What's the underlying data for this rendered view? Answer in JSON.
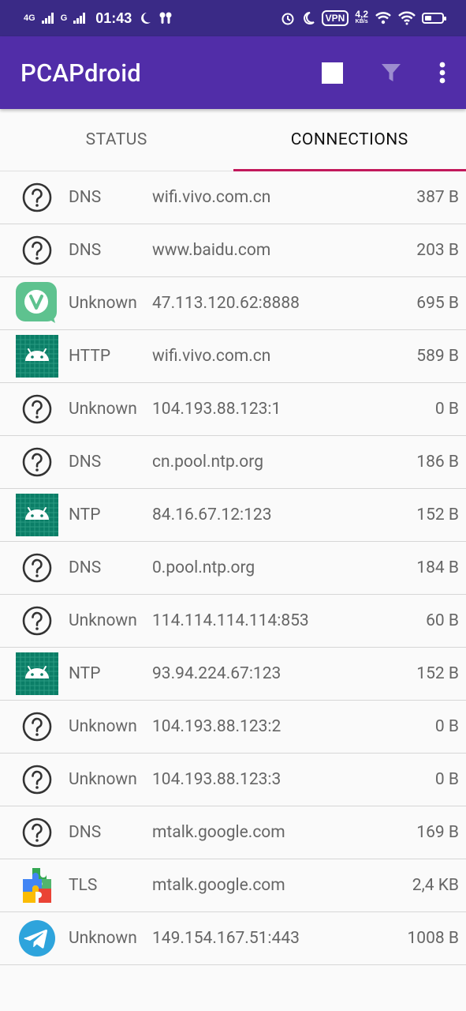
{
  "status_bar": {
    "network_left": "4G",
    "network_right": "G",
    "time": "01:43",
    "vpn": "VPN",
    "speed_value": "4,2",
    "speed_unit": "KB/s"
  },
  "appbar": {
    "title": "PCAPdroid"
  },
  "tabs": [
    {
      "label": "STATUS",
      "active": false
    },
    {
      "label": "CONNECTIONS",
      "active": true
    }
  ],
  "connections": [
    {
      "icon": "unknown-app-icon",
      "protocol": "DNS",
      "host": "wifi.vivo.com.cn",
      "size": "387 B"
    },
    {
      "icon": "unknown-app-icon",
      "protocol": "DNS",
      "host": "www.baidu.com",
      "size": "203 B"
    },
    {
      "icon": "vivo-v-icon",
      "protocol": "Unknown",
      "host": "47.113.120.62:8888",
      "size": "695 B"
    },
    {
      "icon": "android-system-icon",
      "protocol": "HTTP",
      "host": "wifi.vivo.com.cn",
      "size": "589 B"
    },
    {
      "icon": "unknown-app-icon",
      "protocol": "Unknown",
      "host": "104.193.88.123:1",
      "size": "0 B"
    },
    {
      "icon": "unknown-app-icon",
      "protocol": "DNS",
      "host": "cn.pool.ntp.org",
      "size": "186 B"
    },
    {
      "icon": "android-system-icon",
      "protocol": "NTP",
      "host": "84.16.67.12:123",
      "size": "152 B"
    },
    {
      "icon": "unknown-app-icon",
      "protocol": "DNS",
      "host": "0.pool.ntp.org",
      "size": "184 B"
    },
    {
      "icon": "unknown-app-icon",
      "protocol": "Unknown",
      "host": "114.114.114.114:853",
      "size": "60 B"
    },
    {
      "icon": "android-system-icon",
      "protocol": "NTP",
      "host": "93.94.224.67:123",
      "size": "152 B"
    },
    {
      "icon": "unknown-app-icon",
      "protocol": "Unknown",
      "host": "104.193.88.123:2",
      "size": "0 B"
    },
    {
      "icon": "unknown-app-icon",
      "protocol": "Unknown",
      "host": "104.193.88.123:3",
      "size": "0 B"
    },
    {
      "icon": "unknown-app-icon",
      "protocol": "DNS",
      "host": "mtalk.google.com",
      "size": "169 B"
    },
    {
      "icon": "google-play-services-icon",
      "protocol": "TLS",
      "host": "mtalk.google.com",
      "size": "2,4 KB"
    },
    {
      "icon": "telegram-icon",
      "protocol": "Unknown",
      "host": "149.154.167.51:443",
      "size": "1008 B"
    }
  ],
  "colors": {
    "status_bar": "#3a2a86",
    "app_bar": "#512da8",
    "tab_indicator": "#c2185b",
    "android_icon_bg": "#0b7e67",
    "vivo_icon_bg": "#5ec28f",
    "telegram": "#2ea4dc"
  }
}
